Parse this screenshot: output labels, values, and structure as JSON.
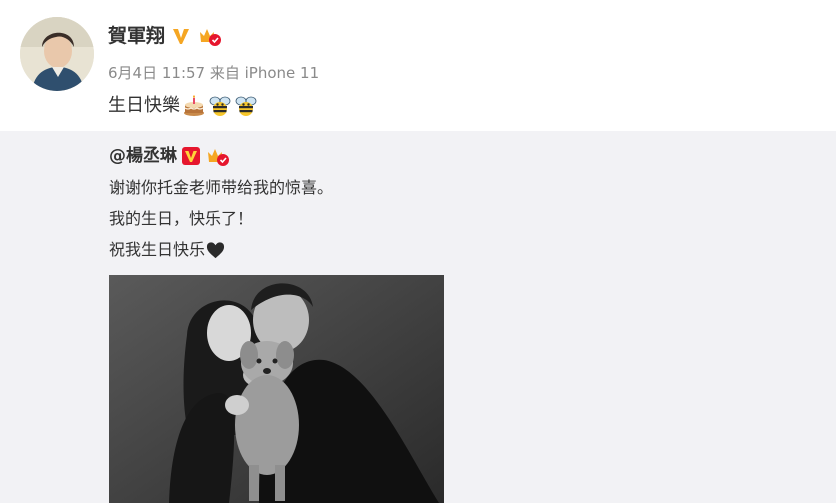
{
  "post": {
    "author": "賀軍翔",
    "meta": "6月4日 11:57 来自 iPhone 11",
    "text": "生日快樂",
    "text_emojis": [
      "cake-emoji",
      "bee-emoji",
      "bee-emoji"
    ]
  },
  "repost": {
    "author": "@楊丞琳",
    "lines": [
      "谢谢你托金老师带给我的惊喜。",
      "我的生日，快乐了！",
      "祝我生日快乐"
    ],
    "line3_emoji": "black-heart-emoji"
  },
  "colors": {
    "verified_gold": "#f5a623",
    "verified_red": "#e6162d",
    "repost_bg": "#f2f2f5",
    "meta_gray": "#8a8a8a"
  }
}
